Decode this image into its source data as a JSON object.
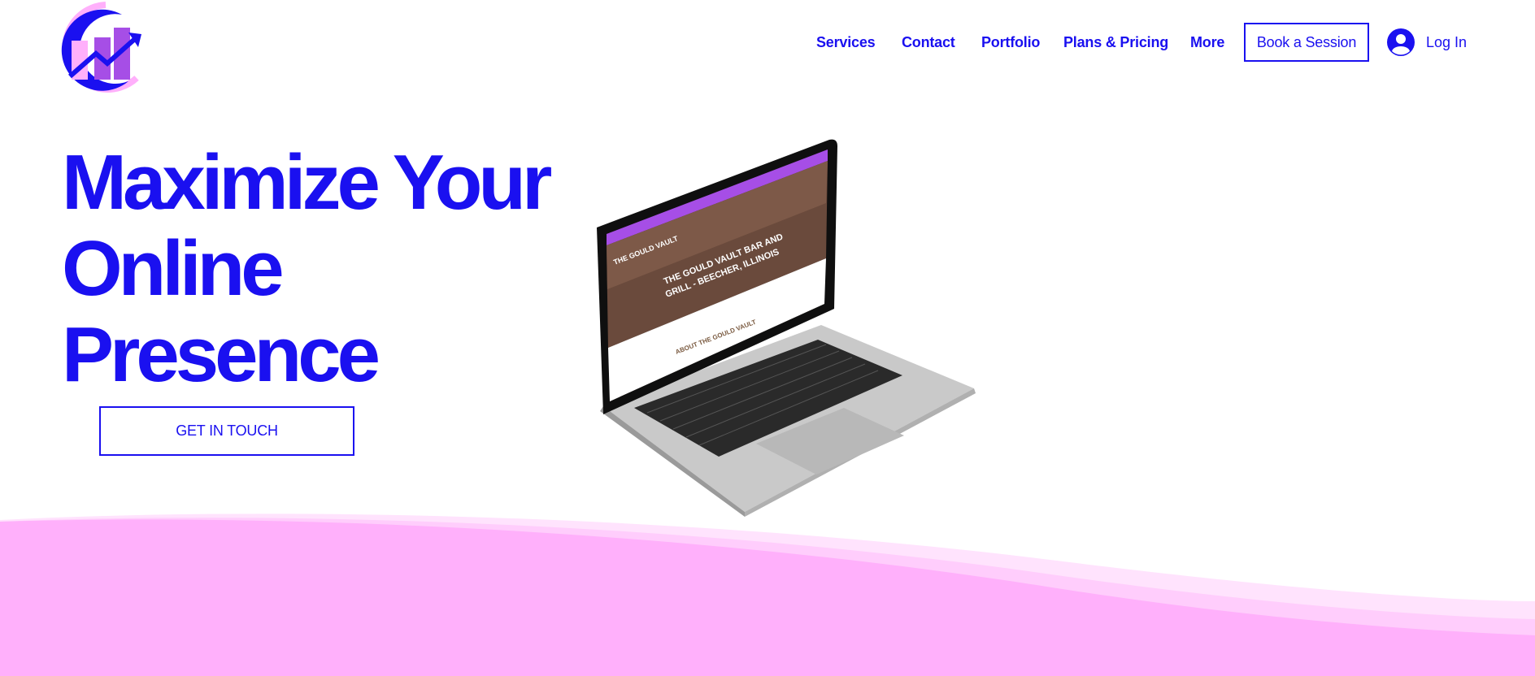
{
  "brand": {
    "logo_icon": "growth-chart-logo",
    "colors": {
      "primary": "#1a10f0",
      "pink": "#ffb0fb",
      "purple": "#a64ee6"
    }
  },
  "nav": {
    "items": [
      {
        "label": "Services"
      },
      {
        "label": "Contact"
      },
      {
        "label": "Portfolio"
      },
      {
        "label": "Plans & Pricing"
      },
      {
        "label": "More"
      }
    ],
    "book_label": "Book a Session",
    "login_label": "Log In",
    "login_icon": "user-avatar-icon"
  },
  "hero": {
    "title_lines": [
      "Maximize Your",
      "Online",
      "Presence"
    ],
    "cta_label": "GET IN TOUCH"
  },
  "laptop_screen": {
    "site_logo": "THE GOULD VAULT",
    "headline_1": "THE GOULD VAULT BAR AND",
    "headline_2": "GRILL - BEECHER, ILLINOIS",
    "about": "ABOUT THE GOULD VAULT"
  }
}
